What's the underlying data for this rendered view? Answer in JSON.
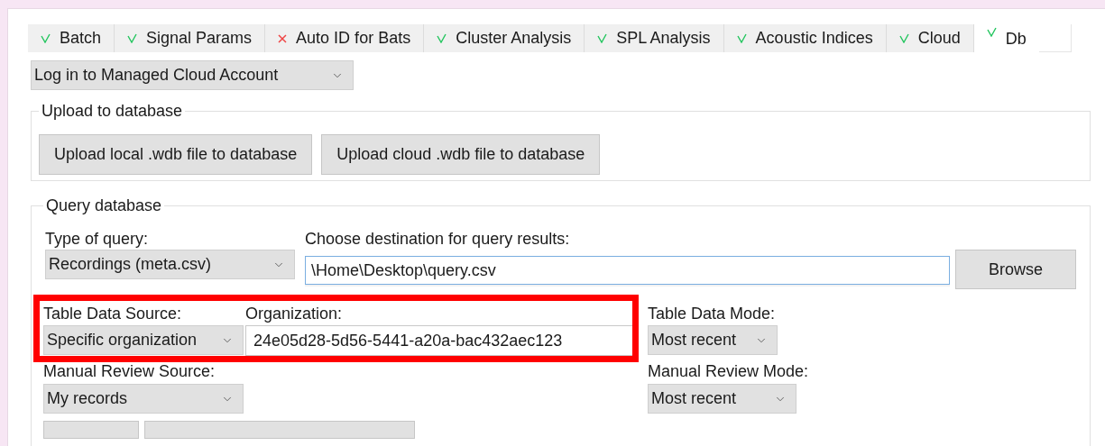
{
  "tabs": [
    {
      "label": "Batch",
      "kind": "ok",
      "selected": false
    },
    {
      "label": "Signal Params",
      "kind": "ok",
      "selected": false
    },
    {
      "label": "Auto ID for Bats",
      "kind": "error",
      "selected": false
    },
    {
      "label": "Cluster Analysis",
      "kind": "ok",
      "selected": false
    },
    {
      "label": "SPL Analysis",
      "kind": "ok",
      "selected": false
    },
    {
      "label": "Acoustic Indices",
      "kind": "ok",
      "selected": false
    },
    {
      "label": "Cloud",
      "kind": "ok",
      "selected": false
    },
    {
      "label": "Db",
      "kind": "ok",
      "selected": true
    }
  ],
  "account_dropdown": {
    "value": "Log in to Managed Cloud Account"
  },
  "upload_group": {
    "title": "Upload to database",
    "buttons": [
      "Upload local .wdb file to database",
      "Upload cloud .wdb file to database"
    ]
  },
  "query_group": {
    "title": "Query database",
    "query_type": {
      "label": "Type of query:",
      "value": "Recordings (meta.csv)"
    },
    "destination": {
      "label": "Choose destination for query results:",
      "value": "\\Home\\Desktop\\query.csv",
      "focused": true
    },
    "browse_button": "Browse",
    "source_row_highlighted": true,
    "table_data_source": {
      "label": "Table Data Source:",
      "value": "Specific organization"
    },
    "organization": {
      "label": "Organization:",
      "value": "24e05d28-5d56-5441-a20a-bac432aec123"
    },
    "table_data_mode": {
      "label": "Table Data Mode:",
      "value": "Most recent"
    },
    "manual_review_source": {
      "label": "Manual Review Source:",
      "value": "My records"
    },
    "manual_review_mode": {
      "label": "Manual Review Mode:",
      "value": "Most recent"
    }
  }
}
